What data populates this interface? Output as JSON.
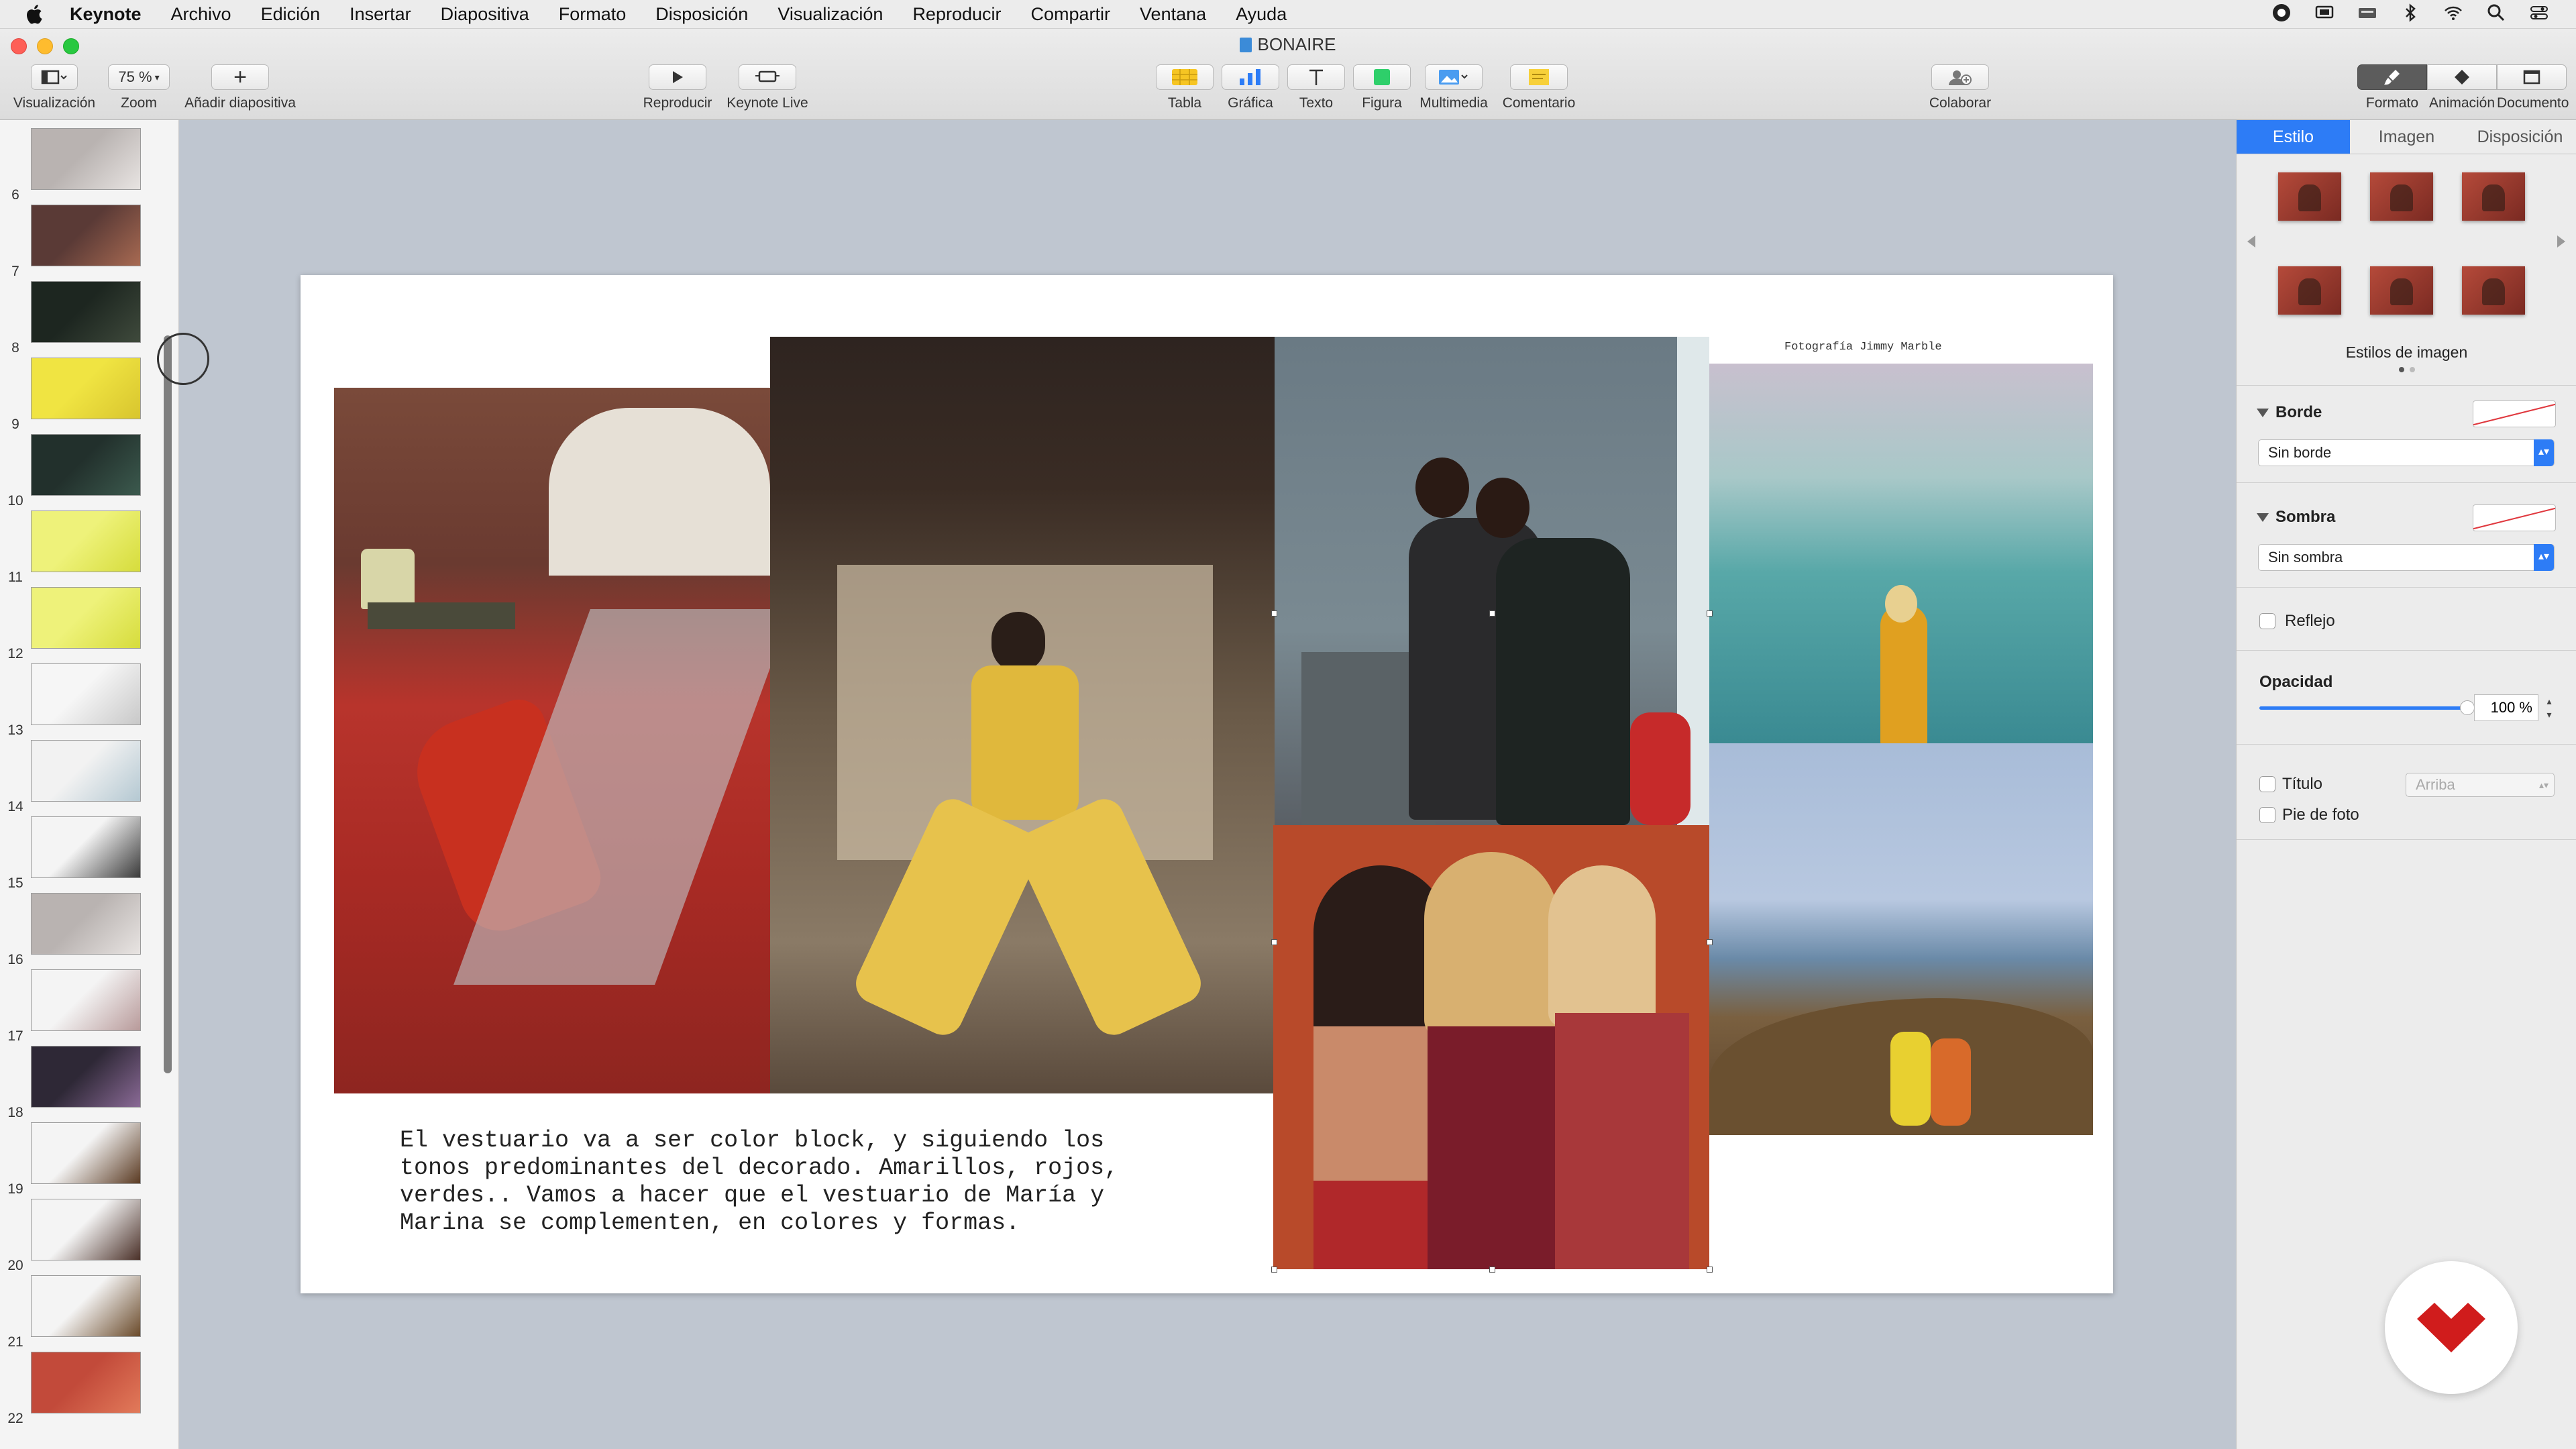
{
  "menubar": {
    "app_name": "Keynote",
    "items": [
      "Archivo",
      "Edición",
      "Insertar",
      "Diapositiva",
      "Formato",
      "Disposición",
      "Visualización",
      "Reproducir",
      "Compartir",
      "Ventana",
      "Ayuda"
    ],
    "status_icons": [
      "record-icon",
      "screen-mirror-icon",
      "keyboard-icon",
      "bluetooth-icon",
      "wifi-icon",
      "search-icon",
      "control-center-icon"
    ]
  },
  "window": {
    "title": "BONAIRE"
  },
  "toolbar": {
    "view_label": "Visualización",
    "zoom_value": "75 %",
    "zoom_label": "Zoom",
    "add_slide_label": "Añadir diapositiva",
    "play_label": "Reproducir",
    "keynote_live_label": "Keynote Live",
    "table_label": "Tabla",
    "chart_label": "Gráfica",
    "text_label": "Texto",
    "shape_label": "Figura",
    "media_label": "Multimedia",
    "comment_label": "Comentario",
    "collaborate_label": "Colaborar",
    "format_label": "Formato",
    "animate_label": "Animación",
    "document_label": "Documento"
  },
  "navigator": {
    "slides": [
      {
        "num": "6",
        "c1": "#b9b3b1",
        "c2": "#e8e4e2"
      },
      {
        "num": "7",
        "c1": "#5a3a36",
        "c2": "#a86a52"
      },
      {
        "num": "8",
        "c1": "#1d2620",
        "c2": "#3f4a3c"
      },
      {
        "num": "9",
        "c1": "#f0e442",
        "c2": "#d8c52e"
      },
      {
        "num": "10",
        "c1": "#22302c",
        "c2": "#3c5a4e"
      },
      {
        "num": "11",
        "c1": "#eef27a",
        "c2": "#d6dc3c"
      },
      {
        "num": "12",
        "c1": "#eef27a",
        "c2": "#d6dc3c"
      },
      {
        "num": "13",
        "c1": "#f6f6f6",
        "c2": "#c8c8c8"
      },
      {
        "num": "14",
        "c1": "#f2f2f2",
        "c2": "#b4c8d2"
      },
      {
        "num": "15",
        "c1": "#f4f4f4",
        "c2": "#3a3a3a"
      },
      {
        "num": "16",
        "c1": "#b9b3b1",
        "c2": "#e8e4e2"
      },
      {
        "num": "17",
        "c1": "#f4f4f4",
        "c2": "#b89a9a"
      },
      {
        "num": "18",
        "c1": "#2e2836",
        "c2": "#8a6a96"
      },
      {
        "num": "19",
        "c1": "#f4f4f4",
        "c2": "#5a3a22"
      },
      {
        "num": "20",
        "c1": "#f4f4f4",
        "c2": "#4a3028"
      },
      {
        "num": "21",
        "c1": "#f4f4f4",
        "c2": "#6a4a2a"
      },
      {
        "num": "22",
        "c1": "#c24a3a",
        "c2": "#e27a5a"
      }
    ]
  },
  "slide": {
    "caption": "El vestuario va a ser color block, y siguiendo los tonos predominantes del decorado. Amarillos, rojos, verdes.. Vamos a hacer que el vestuario de María y Marina se complementen, en colores y formas.",
    "credit": "Fotografía Jimmy Marble"
  },
  "inspector": {
    "tabs": [
      "Estilo",
      "Imagen",
      "Disposición"
    ],
    "image_styles_label": "Estilos de imagen",
    "border_label": "Borde",
    "border_value": "Sin borde",
    "shadow_label": "Sombra",
    "shadow_value": "Sin sombra",
    "reflection_label": "Reflejo",
    "opacity_label": "Opacidad",
    "opacity_value": "100 %",
    "opacity": 1.0,
    "title_label": "Título",
    "title_position": "Arriba",
    "caption_label": "Pie de foto"
  },
  "colors": {
    "accent": "#2d7cf6",
    "logo": "#d01c1c"
  }
}
